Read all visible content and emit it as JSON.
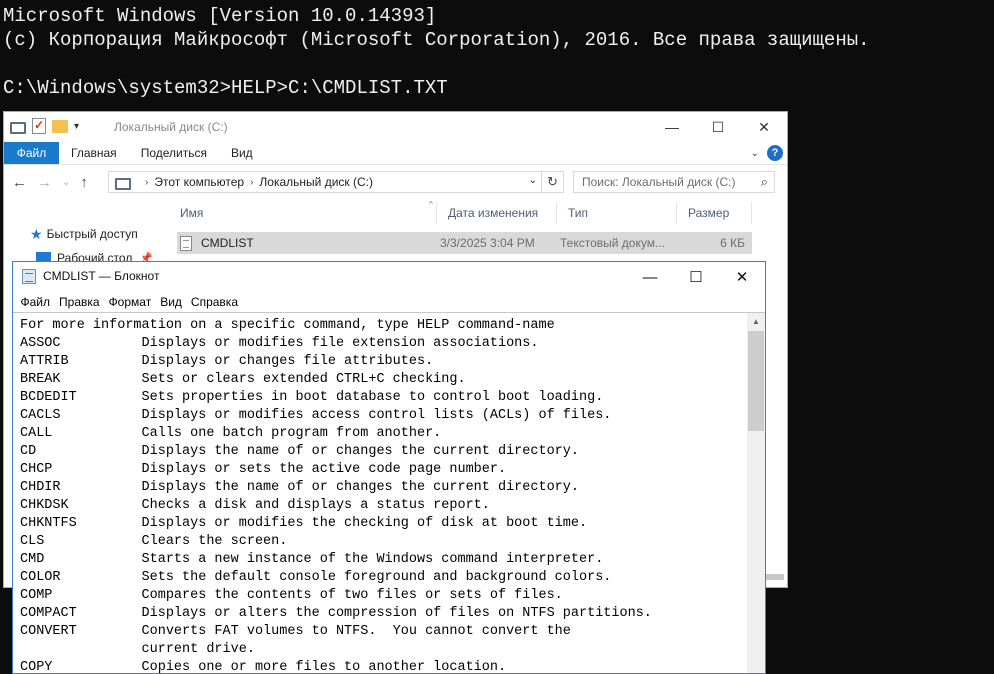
{
  "console": {
    "lines": [
      "Microsoft Windows [Version 10.0.14393]",
      "(с) Корпорация Майкрософт (Microsoft Corporation), 2016. Все права защищены.",
      "",
      "C:\\Windows\\system32>HELP>C:\\CMDLIST.TXT"
    ]
  },
  "explorer": {
    "title": "Локальный диск (C:)",
    "window_buttons": {
      "minimize": "—",
      "maximize": "☐",
      "close": "✕"
    },
    "ribbon_tabs": [
      "Файл",
      "Главная",
      "Поделиться",
      "Вид"
    ],
    "help": "?",
    "address": {
      "part1": "Этот компьютер",
      "part2": "Локальный диск (C:)"
    },
    "search_placeholder": "Поиск: Локальный диск (C:)",
    "nav": {
      "quick_access": "Быстрый доступ",
      "desktop": "Рабочий стол"
    },
    "columns": [
      "Имя",
      "Дата изменения",
      "Тип",
      "Размер"
    ],
    "rows": [
      {
        "name": "CMDLIST",
        "date": "3/3/2025 3:04 PM",
        "type": "Текстовый докум...",
        "size": "6 КБ"
      }
    ]
  },
  "notepad": {
    "title": "CMDLIST — Блокнот",
    "window_buttons": {
      "minimize": "—",
      "maximize": "☐",
      "close": "✕"
    },
    "menu": [
      "Файл",
      "Правка",
      "Формат",
      "Вид",
      "Справка"
    ],
    "lines": [
      "For more information on a specific command, type HELP command-name",
      "ASSOC          Displays or modifies file extension associations.",
      "ATTRIB         Displays or changes file attributes.",
      "BREAK          Sets or clears extended CTRL+C checking.",
      "BCDEDIT        Sets properties in boot database to control boot loading.",
      "CACLS          Displays or modifies access control lists (ACLs) of files.",
      "CALL           Calls one batch program from another.",
      "CD             Displays the name of or changes the current directory.",
      "CHCP           Displays or sets the active code page number.",
      "CHDIR          Displays the name of or changes the current directory.",
      "CHKDSK         Checks a disk and displays a status report.",
      "CHKNTFS        Displays or modifies the checking of disk at boot time.",
      "CLS            Clears the screen.",
      "CMD            Starts a new instance of the Windows command interpreter.",
      "COLOR          Sets the default console foreground and background colors.",
      "COMP           Compares the contents of two files or sets of files.",
      "COMPACT        Displays or alters the compression of files on NTFS partitions.",
      "CONVERT        Converts FAT volumes to NTFS.  You cannot convert the",
      "               current drive.",
      "COPY           Copies one or more files to another location."
    ]
  }
}
